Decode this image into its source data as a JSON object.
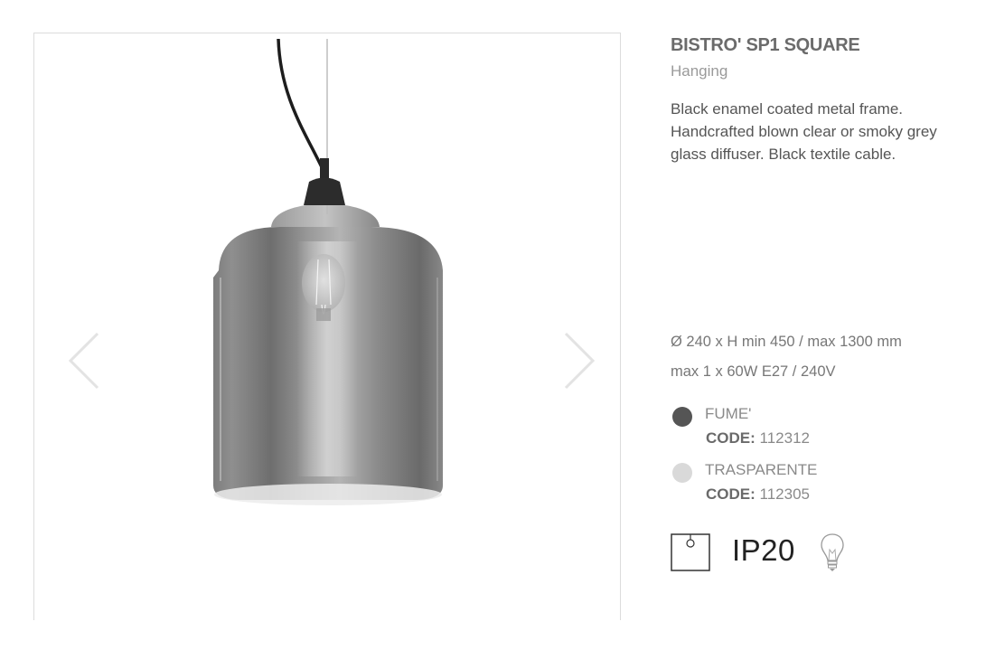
{
  "product": {
    "title": "BISTRO' SP1 SQUARE",
    "category": "Hanging",
    "description": "Black enamel coated metal frame. Handcrafted blown clear or smoky grey glass diffuser. Black textile cable."
  },
  "specs": {
    "dimensions": "Ø 240 x H min 450 / max 1300 mm",
    "power": "max 1 x 60W E27 / 240V"
  },
  "variants": [
    {
      "name": "FUME'",
      "code_label": "CODE:",
      "code": "112312",
      "swatch_color": "#555555"
    },
    {
      "name": "TRASPARENTE",
      "code_label": "CODE:",
      "code": "112305",
      "swatch_color": "#d9d9d9"
    }
  ],
  "certifications": {
    "mount_icon": "ceiling-mount-icon",
    "ip_rating": "IP20",
    "bulb_icon": "light-bulb-icon"
  },
  "gallery": {
    "prev_icon": "chevron-left-icon",
    "next_icon": "chevron-right-icon"
  }
}
